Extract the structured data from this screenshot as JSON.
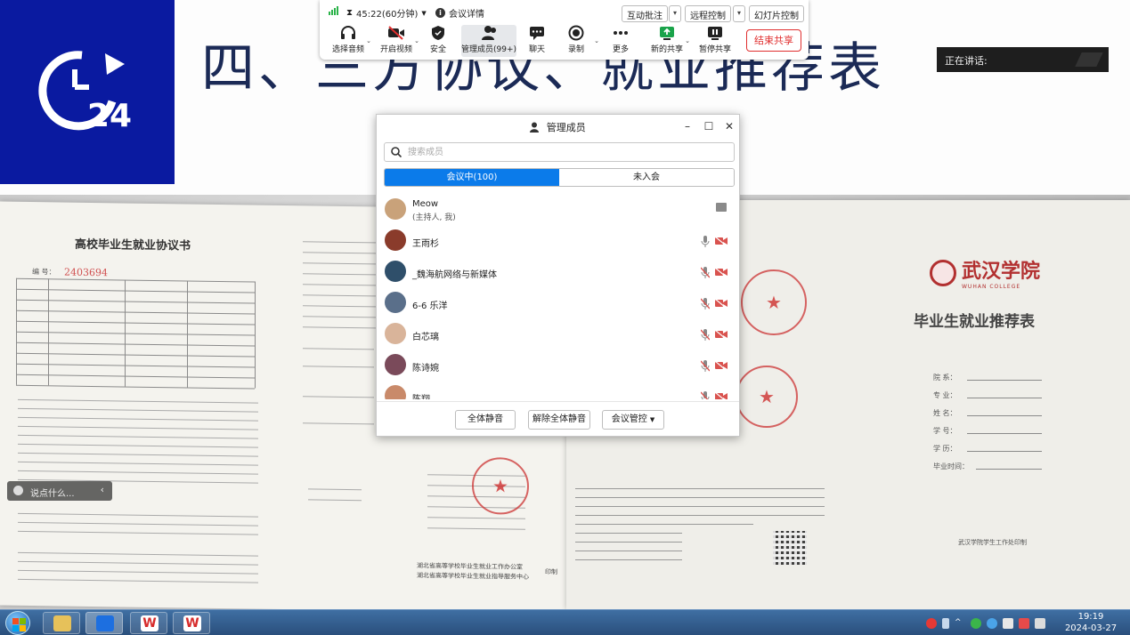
{
  "slide": {
    "title": "四、三方协议、就业推荐表",
    "logo_number": "24",
    "speaking_label": "正在讲话:"
  },
  "documents": {
    "left_heading": "高校毕业生就业协议书",
    "number_label": "编 号：",
    "number_value": "2403694",
    "right_heading": "毕业生就业推荐表",
    "college_name": "武汉学院",
    "college_name_en": "WUHAN COLLEGE",
    "right_fields": [
      "院 系：",
      "专 业：",
      "姓 名：",
      "学 号：",
      "学 历：",
      "毕业时间："
    ],
    "right_footer": "武汉学院学生工作处印制",
    "left_footer_1": "湖北省高等学校毕业生就业工作办公室",
    "left_footer_2": "湖北省高等学校毕业生就业指导服务中心",
    "left_footer_tag": "印制"
  },
  "toolbar": {
    "timer": "45:22(60分钟)",
    "meeting_info": "会议详情",
    "annotate": "互动批注",
    "remote_control": "远程控制",
    "slide_control": "幻灯片控制",
    "tools": [
      {
        "label": "选择音频",
        "icon": "headphone-icon"
      },
      {
        "label": "开启视频",
        "icon": "video-off-icon"
      },
      {
        "label": "安全",
        "icon": "shield-icon"
      },
      {
        "label": "管理成员(99+)",
        "icon": "members-icon"
      },
      {
        "label": "聊天",
        "icon": "chat-icon"
      },
      {
        "label": "录制",
        "icon": "record-icon"
      },
      {
        "label": "更多",
        "icon": "more-icon"
      },
      {
        "label": "新的共享",
        "icon": "new-share-icon"
      },
      {
        "label": "暂停共享",
        "icon": "pause-share-icon"
      }
    ],
    "end_share": "结束共享"
  },
  "members_panel": {
    "title": "管理成员",
    "search_placeholder": "搜索成员",
    "tabs": [
      "会议中(100)",
      "未入会"
    ],
    "members": [
      {
        "name": "Meow",
        "role": "(主持人, 我)",
        "color": "#c9a27a"
      },
      {
        "name": "王雨杉",
        "role": "",
        "color": "#8a3b2b"
      },
      {
        "name": "_魏海航网络与新媒体",
        "role": "",
        "color": "#2f4f6a"
      },
      {
        "name": "6-6  乐洋",
        "role": "",
        "color": "#5a6f8a"
      },
      {
        "name": "白芯璃",
        "role": "",
        "color": "#d9b49a"
      },
      {
        "name": "陈诗婉",
        "role": "",
        "color": "#7a4a5a"
      },
      {
        "name": "陈翔",
        "role": "",
        "color": "#c98a6a"
      }
    ],
    "footer": {
      "mute_all": "全体静音",
      "unmute_all": "解除全体静音",
      "meeting_control": "会议管控"
    }
  },
  "chat_pill": {
    "placeholder": "说点什么..."
  },
  "taskbar": {
    "time": "19:19",
    "date": "2024-03-27"
  },
  "colors": {
    "accent": "#0b7bea",
    "logo_bg": "#0a1aa0",
    "end_share": "#e02e2e",
    "muted_icon": "#d9534f"
  }
}
